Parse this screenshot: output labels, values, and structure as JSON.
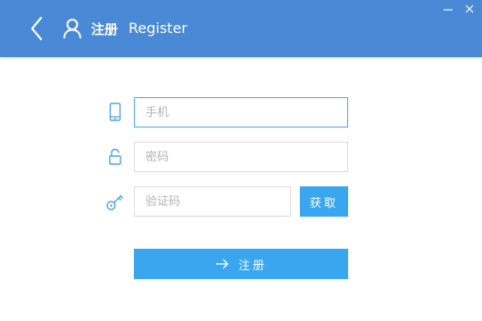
{
  "header": {
    "title_cn": "注册",
    "title_en": "Register"
  },
  "form": {
    "phone": {
      "value": "",
      "placeholder": "手机"
    },
    "password": {
      "value": "",
      "placeholder": "密码"
    },
    "code": {
      "value": "",
      "placeholder": "验证码"
    },
    "get_code_label": "获取",
    "register_label": "注册"
  },
  "colors": {
    "header_bg": "#4a89d6",
    "accent": "#3aa6ef",
    "icon": "#4aa3df",
    "focus_border": "#49a9e3"
  },
  "icons": {
    "back": "chevron-left-icon",
    "user": "user-icon",
    "phone": "phone-icon",
    "lock": "lock-icon",
    "key": "key-icon",
    "arrow": "arrow-right-icon",
    "minimize": "minimize-icon",
    "close": "close-icon"
  }
}
